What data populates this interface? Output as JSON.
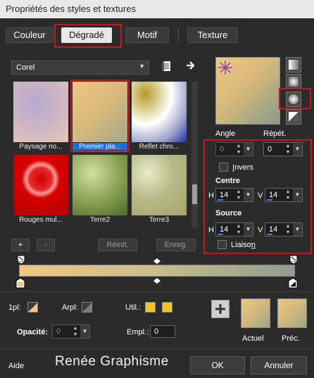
{
  "window": {
    "title": "Propriétés des styles et textures"
  },
  "tabs": [
    {
      "label": "Couleur",
      "active": false
    },
    {
      "label": "Dégradé",
      "active": true
    },
    {
      "label": "Motif",
      "active": false
    },
    {
      "label": "Texture",
      "active": false
    }
  ],
  "library": {
    "selected": "Corel",
    "options": [
      "Corel"
    ]
  },
  "gradients": [
    {
      "label": "Paysage no...",
      "selected": false
    },
    {
      "label": "Premier pla...",
      "selected": true
    },
    {
      "label": "Reflet chro...",
      "selected": false
    },
    {
      "label": "Rouges mul...",
      "selected": false
    },
    {
      "label": "Terre2",
      "selected": false
    },
    {
      "label": "Terre3",
      "selected": false
    }
  ],
  "list_buttons": {
    "add": "+",
    "remove": "-",
    "reset": "Réinit.",
    "save": "Enreg."
  },
  "params": {
    "angle_label": "Angle",
    "angle_value": "0",
    "repeat_label": "Répét.",
    "repeat_value": "0",
    "invert_label": "Invers",
    "invert_checked": false,
    "centre_label": "Centre",
    "centre_h": "14",
    "centre_v": "14",
    "source_label": "Source",
    "source_h": "14",
    "source_v": "14",
    "h_label": "H",
    "v_label": "V",
    "link_label": "Liaison",
    "link_checked": false
  },
  "bottom": {
    "first_plan_label": "1pl:",
    "background_label": "Arpl:",
    "util_label": "Util.:",
    "opacity_label": "Opacité:",
    "opacity_value": "0",
    "location_label": "Empl.:",
    "location_value": "0",
    "add_button": "+",
    "current_label": "Actuel",
    "previous_label": "Préc."
  },
  "footer": {
    "help_label": "Aide",
    "brand_text": "Renée Graphisme",
    "ok_label": "OK",
    "cancel_label": "Annuler"
  },
  "colors": {
    "accent_red": "#c8161d",
    "selection_blue": "#1a6fd8",
    "gradient_start": "#f0c780",
    "gradient_end": "#8e9d8f",
    "util_swatch": "#f2c12e"
  },
  "icons": [
    "document-icon",
    "arrow-right-icon",
    "star-cursor-icon",
    "plus-icon"
  ]
}
